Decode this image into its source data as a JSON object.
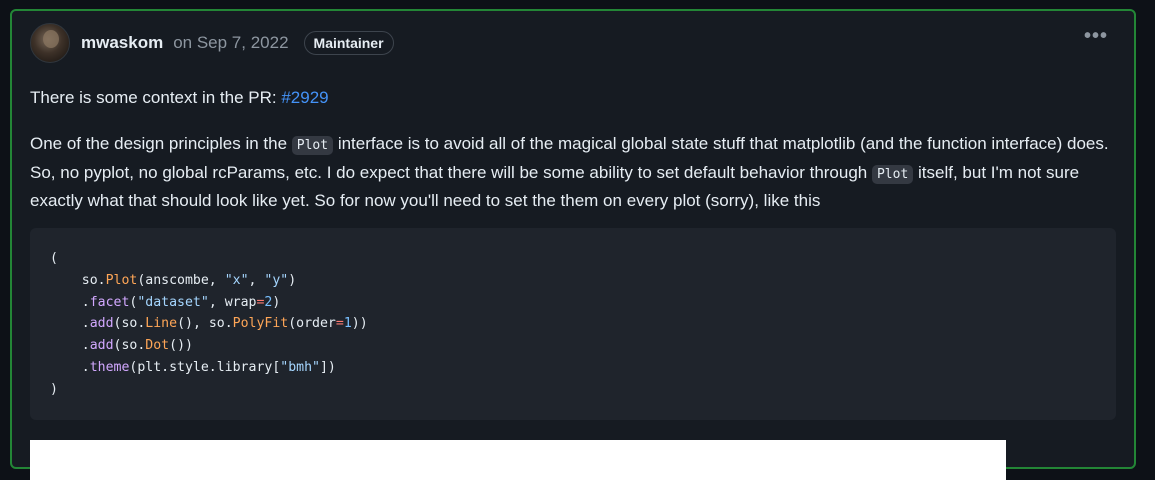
{
  "comment": {
    "author": "mwaskom",
    "date": "on Sep 7, 2022",
    "badge": "Maintainer",
    "menu_icon": "kebab-horizontal-icon",
    "para1_text": "There is some context in the PR: ",
    "para1_link": "#2929",
    "para2": {
      "s1": "One of the design principles in the ",
      "code1": "Plot",
      "s2": " interface is to avoid all of the magical global state stuff that matplotlib (and the function interface) does. So, no pyplot, no global rcParams, etc. I do expect that there will be some ability to set default behavior through ",
      "code2": "Plot",
      "s3": " itself, but I'm not sure exactly what that should look like yet. So for now you'll need to set the them on every plot (sorry), like this"
    },
    "code": {
      "l1": "(",
      "l2_a": "    so.",
      "l2_fn": "Plot",
      "l2_b": "(anscombe, ",
      "l2_s1": "\"x\"",
      "l2_c": ", ",
      "l2_s2": "\"y\"",
      "l2_d": ")",
      "l3_a": "    .",
      "l3_m": "facet",
      "l3_b": "(",
      "l3_s": "\"dataset\"",
      "l3_c": ", wrap",
      "l3_eq": "=",
      "l3_n": "2",
      "l3_d": ")",
      "l4_a": "    .",
      "l4_m": "add",
      "l4_b": "(so.",
      "l4_fn1": "Line",
      "l4_c": "(), so.",
      "l4_fn2": "PolyFit",
      "l4_d": "(order",
      "l4_eq": "=",
      "l4_n": "1",
      "l4_e": "))",
      "l5_a": "    .",
      "l5_m": "add",
      "l5_b": "(so.",
      "l5_fn": "Dot",
      "l5_c": "())",
      "l6_a": "    .",
      "l6_m": "theme",
      "l6_b": "(plt.style.library[",
      "l6_s": "\"bmh\"",
      "l6_c": "])",
      "l7": ")"
    }
  },
  "colors": {
    "accent_border": "#238636",
    "link": "#4493f8",
    "background": "#0d1117",
    "card": "#161b22"
  }
}
